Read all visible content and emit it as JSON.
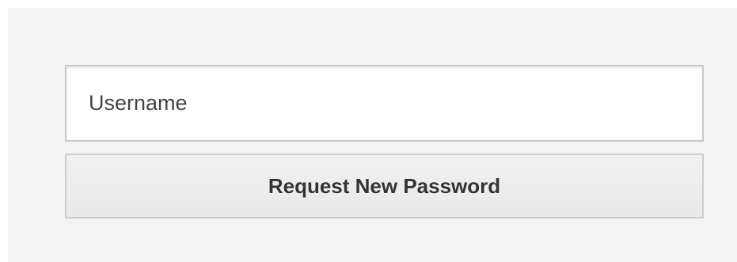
{
  "form": {
    "username_placeholder": "Username",
    "username_value": "",
    "submit_label": "Request New Password"
  },
  "colors": {
    "panel_background": "#f3f3f3",
    "input_background": "#ffffff",
    "border": "#c9c9c9",
    "button_background": "#ececec",
    "text": "#333333"
  }
}
